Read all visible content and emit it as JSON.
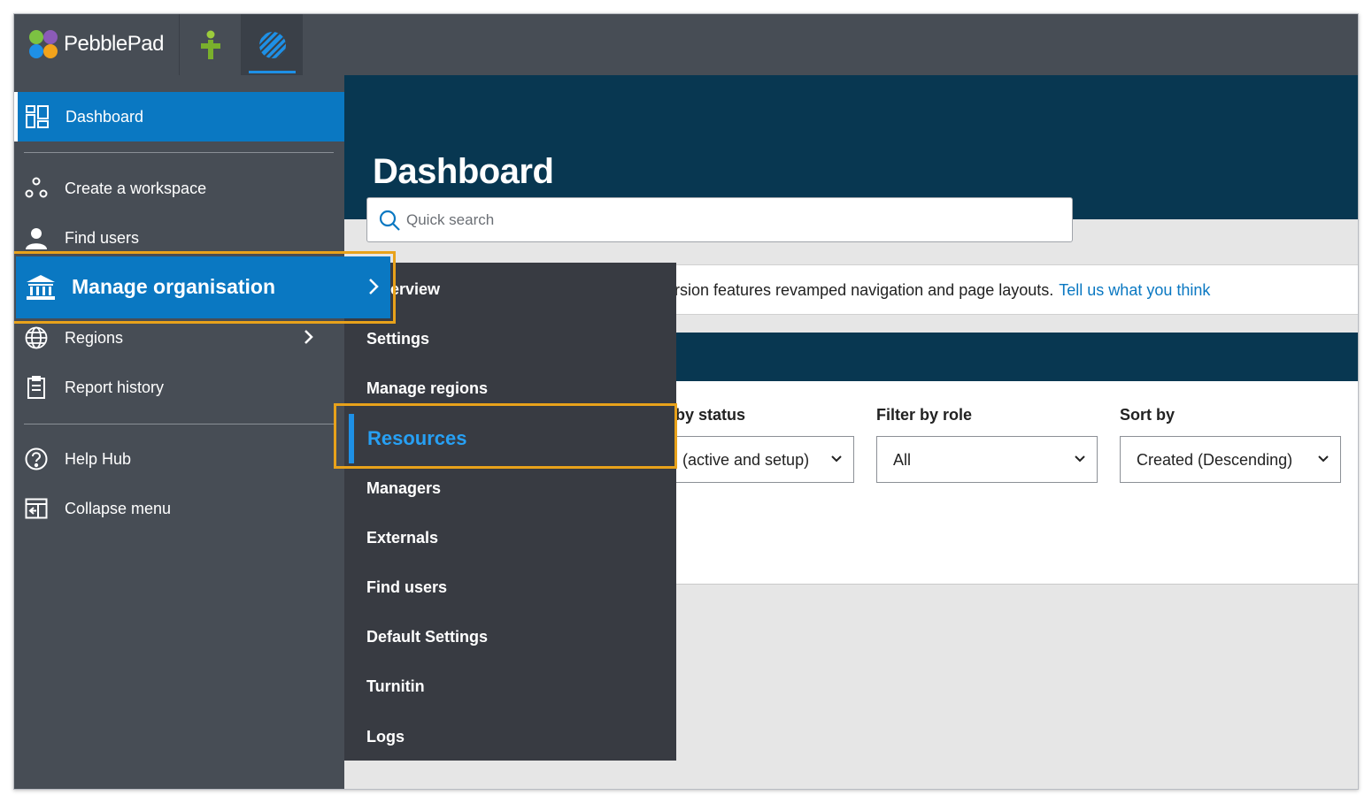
{
  "brand": {
    "name": "PebblePad"
  },
  "sidebar": {
    "items": [
      {
        "label": "Dashboard",
        "icon": "dashboard-icon"
      },
      {
        "label": "Create a workspace",
        "icon": "workspace-icon"
      },
      {
        "label": "Find users",
        "icon": "user-icon"
      },
      {
        "label": "Manage organisation",
        "icon": "institution-icon"
      },
      {
        "label": "Regions",
        "icon": "globe-icon"
      },
      {
        "label": "Report history",
        "icon": "clipboard-icon"
      },
      {
        "label": "Help Hub",
        "icon": "help-icon"
      },
      {
        "label": "Collapse menu",
        "icon": "collapse-icon"
      }
    ]
  },
  "submenu": {
    "items": [
      {
        "label": "erview"
      },
      {
        "label": "Settings"
      },
      {
        "label": "Manage regions"
      },
      {
        "label": "Resources"
      },
      {
        "label": "Managers"
      },
      {
        "label": "Externals"
      },
      {
        "label": "Find users"
      },
      {
        "label": "Default Settings"
      },
      {
        "label": "Turnitin"
      },
      {
        "label": "Logs"
      }
    ]
  },
  "main": {
    "title": "Dashboard",
    "search": {
      "placeholder": "Quick search"
    },
    "banner": {
      "text": "rsion features revamped navigation and page layouts.",
      "link": "Tell us what you think"
    },
    "filters": [
      {
        "label": "by status",
        "value": "(active and setup)"
      },
      {
        "label": "Filter by role",
        "value": "All"
      },
      {
        "label": "Sort by",
        "value": "Created (Descending)"
      }
    ]
  },
  "colors": {
    "sidebar": "#474d55",
    "active": "#0a78c2",
    "hero": "#083751",
    "flyout": "#383b42",
    "highlight": "#e8a21b",
    "link": "#0a78c2"
  }
}
